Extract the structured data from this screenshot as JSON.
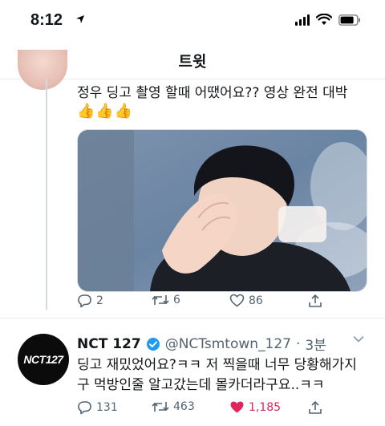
{
  "status_bar": {
    "time": "8:12"
  },
  "nav": {
    "title": "트윗"
  },
  "reply_tweet": {
    "text": "정우 딩고 촬영 할때 어땠어요?? 영상 완전 대박",
    "emoji": "👍👍👍",
    "actions": {
      "replies": "2",
      "retweets": "6",
      "likes": "86"
    }
  },
  "main_tweet": {
    "display_name": "NCT 127",
    "handle": "@NCTsmtown_127",
    "separator": "·",
    "time": "3분",
    "avatar_text": "NCT127",
    "text_line1": "딩고 재밌었어요?ㅋㅋ 저 찍을때 너무 당황해가지",
    "text_line2": "구 먹방인줄 알고갔는데 몰카더라구요..ㅋㅋ",
    "actions": {
      "replies": "131",
      "retweets": "463",
      "likes": "1,185"
    }
  },
  "colors": {
    "verified": "#1d9bf0",
    "liked": "#e0245e",
    "back_arrow": "#1d9bf0",
    "meta": "#536471"
  }
}
